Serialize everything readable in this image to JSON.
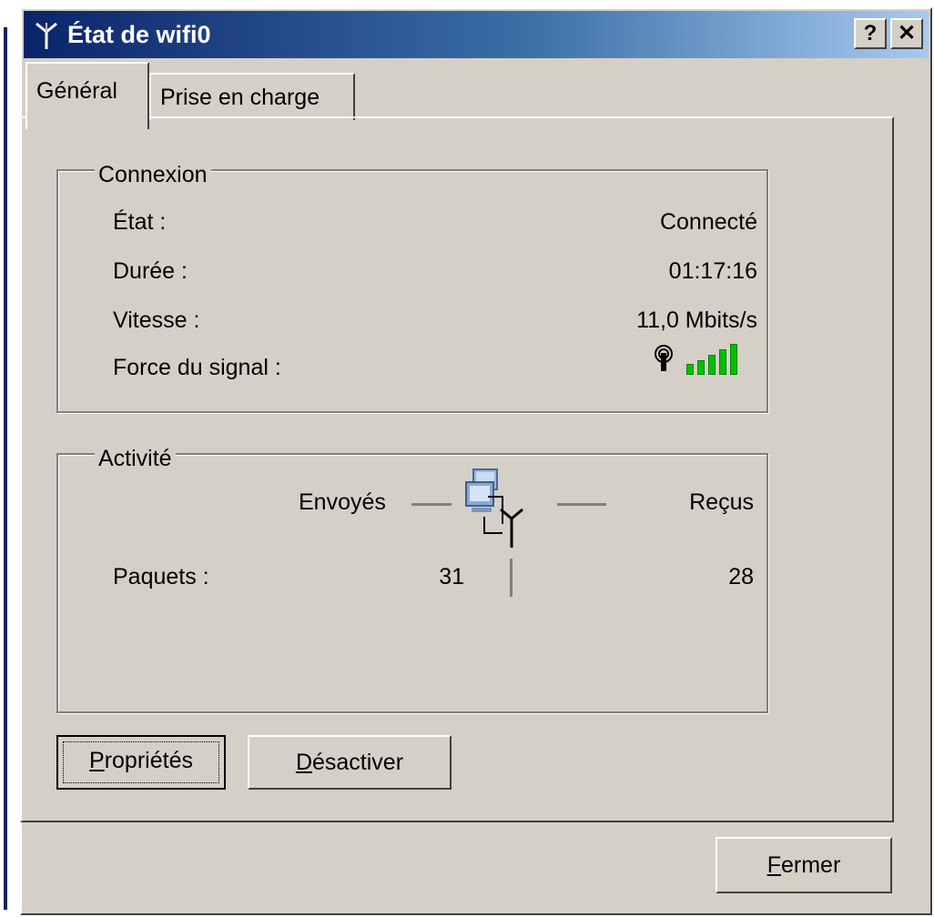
{
  "window": {
    "title": "État de wifi0",
    "help_button": "?",
    "close_button": "✕"
  },
  "tabs": [
    {
      "label": "Général",
      "active": true
    },
    {
      "label": "Prise en charge",
      "active": false
    }
  ],
  "connexion": {
    "title": "Connexion",
    "rows": [
      {
        "label": "État :",
        "value": "Connecté"
      },
      {
        "label": "Durée :",
        "value": "01:17:16"
      },
      {
        "label": "Vitesse :",
        "value": "11,0 Mbits/s"
      },
      {
        "label": "Force du signal :"
      }
    ],
    "signal": {
      "bars_total": 5,
      "bars_lit": 5,
      "color": "#00c000",
      "icon": "antenna-icon"
    }
  },
  "activite": {
    "title": "Activité",
    "sent_label": "Envoyés",
    "received_label": "Reçus",
    "packets_label": "Paquets :",
    "packets_sent": "31",
    "packets_received": "28",
    "icon": "network-activity-icon"
  },
  "buttons": {
    "properties_access": "P",
    "properties_rest": "ropriétés",
    "disable_access": "D",
    "disable_rest": "ésactiver",
    "close_access": "F",
    "close_rest": "ermer"
  },
  "colors": {
    "titlebar_start": "#0a246a",
    "titlebar_end": "#a6caf0",
    "face": "#d4d0c8",
    "signal": "#00c000"
  }
}
